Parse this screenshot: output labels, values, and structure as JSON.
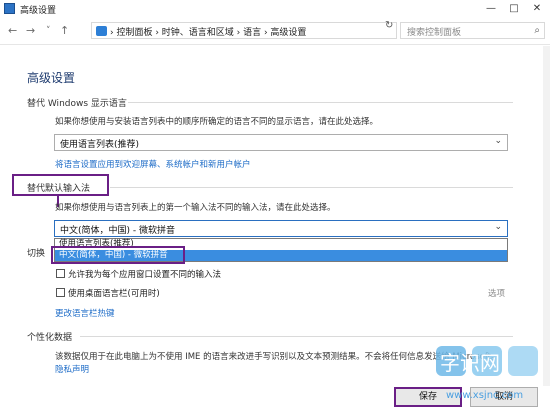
{
  "window": {
    "title": "高级设置",
    "min": "—",
    "max": "□",
    "close": "✕"
  },
  "address": {
    "back": "←",
    "forward": "→",
    "history": "˅",
    "up": "↑",
    "breadcrumb": "› 控制面板 › 时钟、语言和区域 › 语言 › 高级设置",
    "refresh": "↻",
    "search_placeholder": "搜索控制面板",
    "search_icon": "⌕"
  },
  "main": {
    "title": "高级设置",
    "display_lang": {
      "heading": "替代 Windows 显示语言",
      "desc": "如果你想使用与安装语言列表中的顺序所确定的语言不同的显示语言，请在此处选择。",
      "value": "使用语言列表(推荐)",
      "chevron": "⌄",
      "link": "将语言设置应用到欢迎屏幕、系统帐户和新用户帐户"
    },
    "input_method": {
      "heading": "替代默认输入法",
      "desc": "如果你想使用与语言列表上的第一个输入法不同的输入法，请在此处选择。",
      "value": "中文(简体，中国) - 微软拼音",
      "chevron": "⌄",
      "options": [
        "使用语言列表(推荐)",
        "中文(简体，中国) - 微软拼音"
      ]
    },
    "switch": {
      "heading_partial": "切换",
      "checkbox1": "允许我为每个应用窗口设置不同的输入法",
      "checkbox2": "使用桌面语言栏(可用时)",
      "options_label": "选项",
      "link": "更改语言栏热键"
    },
    "personal": {
      "heading": "个性化数据",
      "desc": "该数据仅用于在此电脑上为不使用 IME 的语言来改进手写识别以及文本预测结果。不会将任何信息发送给 Microsoft。",
      "link": "隐私声明"
    },
    "save": "保存",
    "cancel": "取消"
  },
  "watermark": {
    "text": "字识网",
    "url": "www.xsjnc.com"
  }
}
